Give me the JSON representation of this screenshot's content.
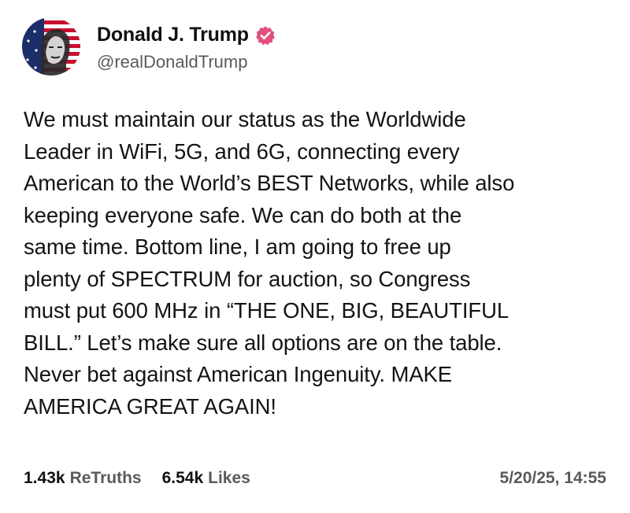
{
  "author": {
    "display_name": "Donald J. Trump",
    "handle": "@realDonaldTrump",
    "verified": true,
    "verified_icon": "verified-badge-icon",
    "verified_color": "#e34f7c"
  },
  "post": {
    "text": "We must maintain our status as the Worldwide\nLeader in WiFi, 5G, and 6G, connecting every\nAmerican to the World’s BEST Networks, while also\nkeeping everyone safe. We can do both at the\nsame time. Bottom line, I am going to free up\nplenty of SPECTRUM for auction, so Congress\nmust put 600 MHz in “THE ONE, BIG, BEAUTIFUL\nBILL.” Let’s make sure all options are on the table.\nNever bet against American Ingenuity. MAKE\nAMERICA GREAT AGAIN!"
  },
  "stats": {
    "retruths_count": "1.43k",
    "retruths_label": "ReTruths",
    "likes_count": "6.54k",
    "likes_label": "Likes",
    "timestamp": "5/20/25, 14:55"
  }
}
